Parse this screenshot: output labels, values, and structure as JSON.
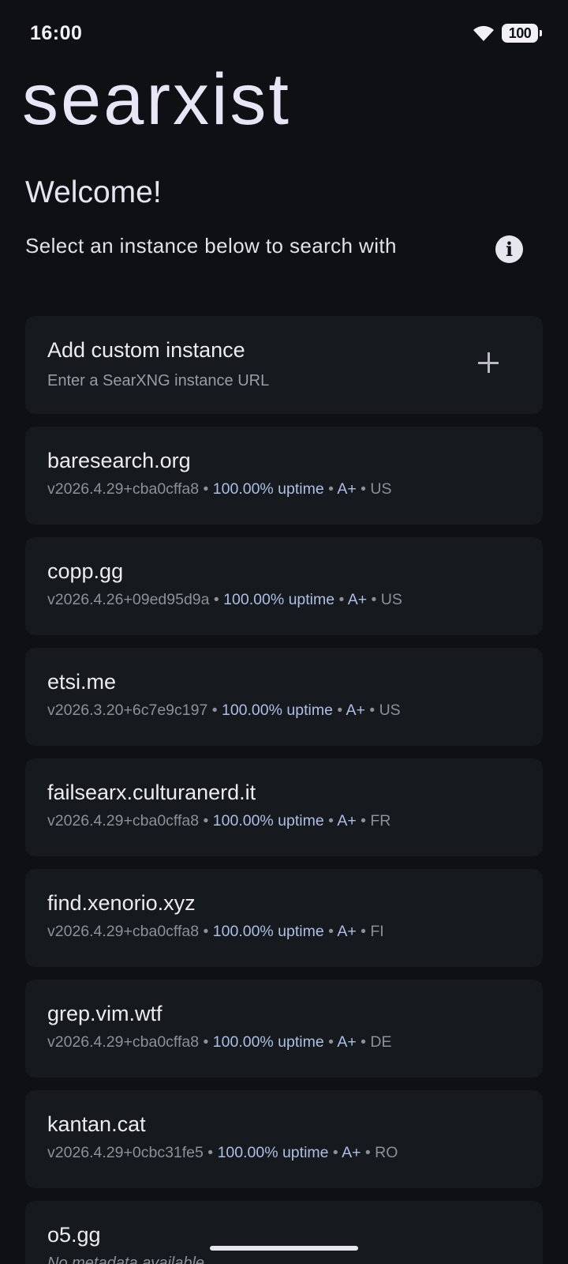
{
  "status_bar": {
    "time": "16:00",
    "battery": "100",
    "icons": [
      "wifi-icon",
      "battery-icon"
    ]
  },
  "app": {
    "logo_text": "searxist"
  },
  "welcome": {
    "title": "Welcome!",
    "subtitle": "Select an instance below to search with",
    "info_icon": "info-icon"
  },
  "custom_instance": {
    "title": "Add custom instance",
    "subtitle": "Enter a SearXNG instance URL",
    "icon": "plus-icon"
  },
  "instances": [
    {
      "host": "baresearch.org",
      "version": "v2026.4.29+cba0cffa8",
      "uptime": "100.00% uptime",
      "grade": "A+",
      "country": "US"
    },
    {
      "host": "copp.gg",
      "version": "v2026.4.26+09ed95d9a",
      "uptime": "100.00% uptime",
      "grade": "A+",
      "country": "US"
    },
    {
      "host": "etsi.me",
      "version": "v2026.3.20+6c7e9c197",
      "uptime": "100.00% uptime",
      "grade": "A+",
      "country": "US"
    },
    {
      "host": "failsearx.culturanerd.it",
      "version": "v2026.4.29+cba0cffa8",
      "uptime": "100.00% uptime",
      "grade": "A+",
      "country": "FR"
    },
    {
      "host": "find.xenorio.xyz",
      "version": "v2026.4.29+cba0cffa8",
      "uptime": "100.00% uptime",
      "grade": "A+",
      "country": "FI"
    },
    {
      "host": "grep.vim.wtf",
      "version": "v2026.4.29+cba0cffa8",
      "uptime": "100.00% uptime",
      "grade": "A+",
      "country": "DE"
    },
    {
      "host": "kantan.cat",
      "version": "v2026.4.29+0cbc31fe5",
      "uptime": "100.00% uptime",
      "grade": "A+",
      "country": "RO"
    },
    {
      "host": "o5.gg",
      "note": "No metadata available"
    }
  ],
  "separator": " • ",
  "colors": {
    "background": "#0e1014",
    "card": "#16191e",
    "accent": "#aebfe6",
    "muted": "#8e9099"
  }
}
